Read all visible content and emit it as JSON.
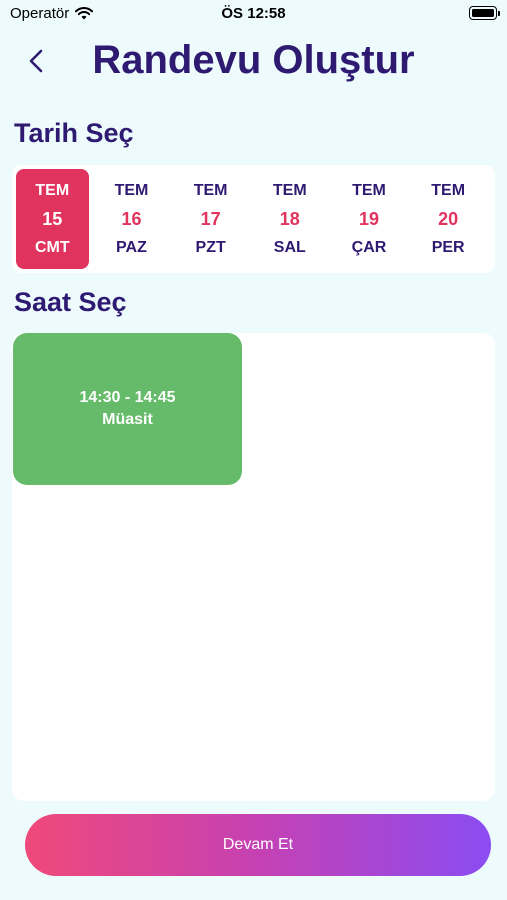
{
  "status_bar": {
    "carrier": "Operatör",
    "time": "ÖS 12:58"
  },
  "header": {
    "title": "Randevu Oluştur"
  },
  "date_section": {
    "title": "Tarih Seç"
  },
  "dates": [
    {
      "month": "TEM",
      "day": "15",
      "weekday": "CMT",
      "selected": true
    },
    {
      "month": "TEM",
      "day": "16",
      "weekday": "PAZ",
      "selected": false
    },
    {
      "month": "TEM",
      "day": "17",
      "weekday": "PZT",
      "selected": false
    },
    {
      "month": "TEM",
      "day": "18",
      "weekday": "SAL",
      "selected": false
    },
    {
      "month": "TEM",
      "day": "19",
      "weekday": "ÇAR",
      "selected": false
    },
    {
      "month": "TEM",
      "day": "20",
      "weekday": "PER",
      "selected": false
    }
  ],
  "time_section": {
    "title": "Saat Seç"
  },
  "slots": [
    {
      "time": "14:30 - 14:45",
      "status": "Müasit"
    }
  ],
  "continue_label": "Devam Et",
  "colors": {
    "accent": "#e0335d",
    "title": "#2f1a72",
    "available": "#66bb6a",
    "background": "#eefbfc"
  }
}
